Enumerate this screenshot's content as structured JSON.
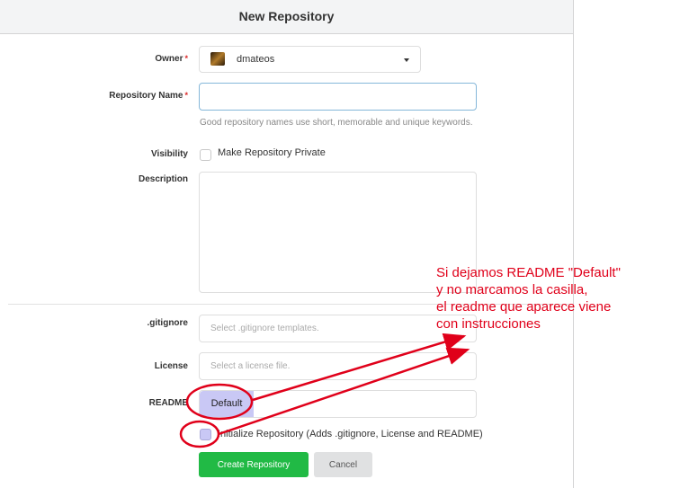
{
  "header": {
    "title": "New Repository"
  },
  "owner": {
    "label": "Owner",
    "required_mark": "*",
    "value": "dmateos"
  },
  "repo_name": {
    "label": "Repository Name",
    "required_mark": "*",
    "value": "",
    "hint": "Good repository names use short, memorable and unique keywords."
  },
  "visibility": {
    "label": "Visibility",
    "checkbox_label": "Make Repository Private",
    "checked": false
  },
  "description": {
    "label": "Description",
    "value": ""
  },
  "gitignore": {
    "label": ".gitignore",
    "placeholder": "Select .gitignore templates."
  },
  "license": {
    "label": "License",
    "placeholder": "Select a license file."
  },
  "readme": {
    "label": "README",
    "value": "Default"
  },
  "auto_init": {
    "checkbox_label": "Initialize Repository (Adds .gitignore, License and README)",
    "checked": false
  },
  "buttons": {
    "create": "Create Repository",
    "cancel": "Cancel"
  },
  "annotation": {
    "text": "Si dejamos README \"Default\"\ny no marcamos la casilla,\nel readme que aparece viene\ncon instrucciones",
    "color": "#e0001a",
    "highlight_color": "#c9c8f5"
  }
}
